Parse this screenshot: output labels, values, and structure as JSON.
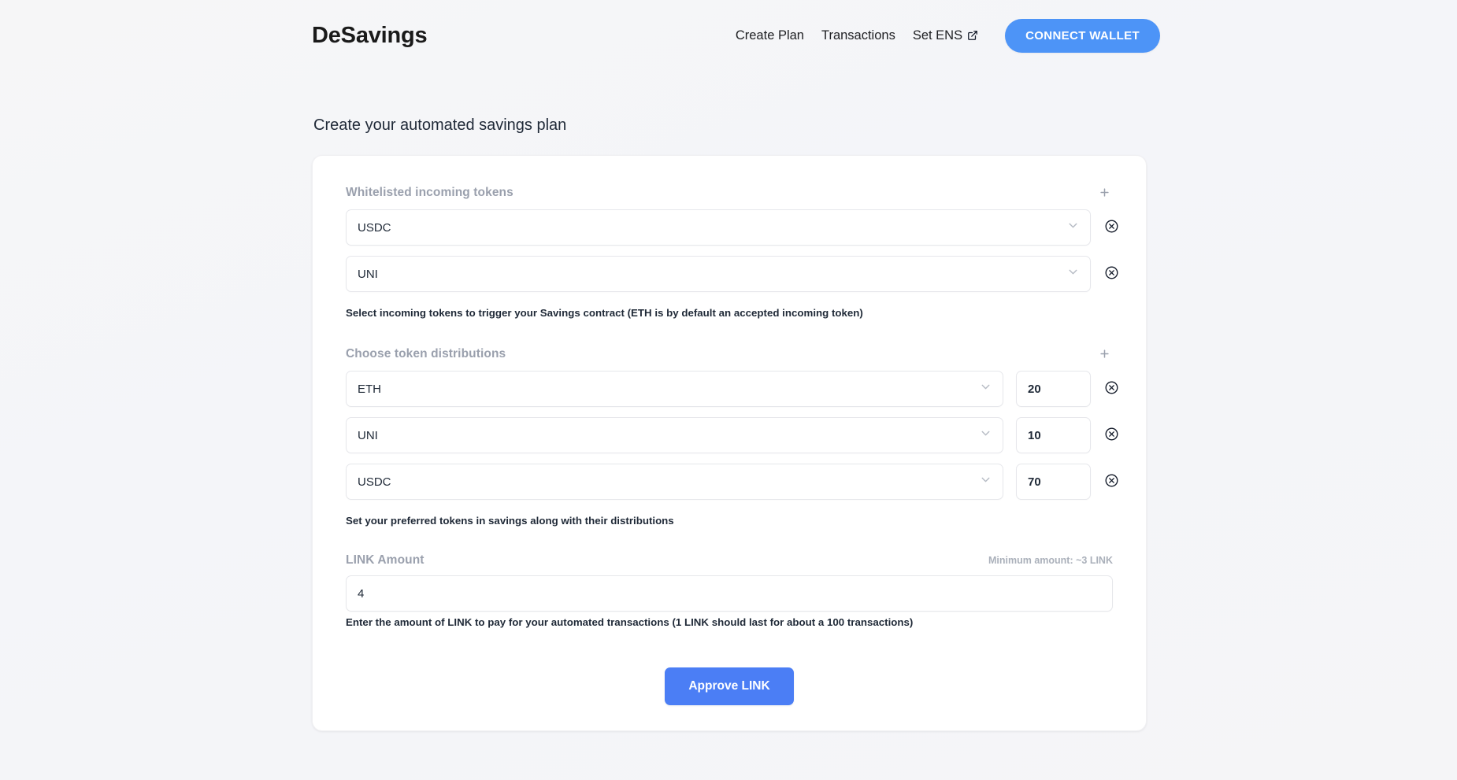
{
  "header": {
    "brand": "DeSavings",
    "nav": [
      {
        "label": "Create Plan",
        "icon": null
      },
      {
        "label": "Transactions",
        "icon": null
      },
      {
        "label": "Set ENS",
        "icon": "external-link-icon"
      }
    ],
    "connect_label": "CONNECT WALLET",
    "accent_color": "#4d94f7"
  },
  "page": {
    "title": "Create your automated savings plan"
  },
  "whitelist_section": {
    "label": "Whitelisted incoming tokens",
    "add_icon": "plus-icon",
    "rows": [
      {
        "token": "USDC",
        "remove_icon": "circle-x-icon",
        "chevron": "chevron-down-icon"
      },
      {
        "token": "UNI",
        "remove_icon": "circle-x-icon",
        "chevron": "chevron-down-icon"
      }
    ],
    "helper": "Select incoming tokens to trigger your Savings contract (ETH is by default an accepted incoming token)"
  },
  "distribution_section": {
    "label": "Choose token distributions",
    "add_icon": "plus-icon",
    "rows": [
      {
        "token": "ETH",
        "amount": "20",
        "remove_icon": "circle-x-icon",
        "chevron": "chevron-down-icon"
      },
      {
        "token": "UNI",
        "amount": "10",
        "remove_icon": "circle-x-icon",
        "chevron": "chevron-down-icon"
      },
      {
        "token": "USDC",
        "amount": "70",
        "remove_icon": "circle-x-icon",
        "chevron": "chevron-down-icon"
      }
    ],
    "helper": "Set your preferred tokens in savings along with their distributions"
  },
  "link_section": {
    "label": "LINK Amount",
    "minimum_note": "Minimum amount: ~3 LINK",
    "value": "4",
    "placeholder": "",
    "helper": "Enter the amount of LINK to pay for your automated transactions (1 LINK should last for about a 100 transactions)"
  },
  "submit": {
    "label": "Approve LINK",
    "color": "#4b7ef5"
  }
}
